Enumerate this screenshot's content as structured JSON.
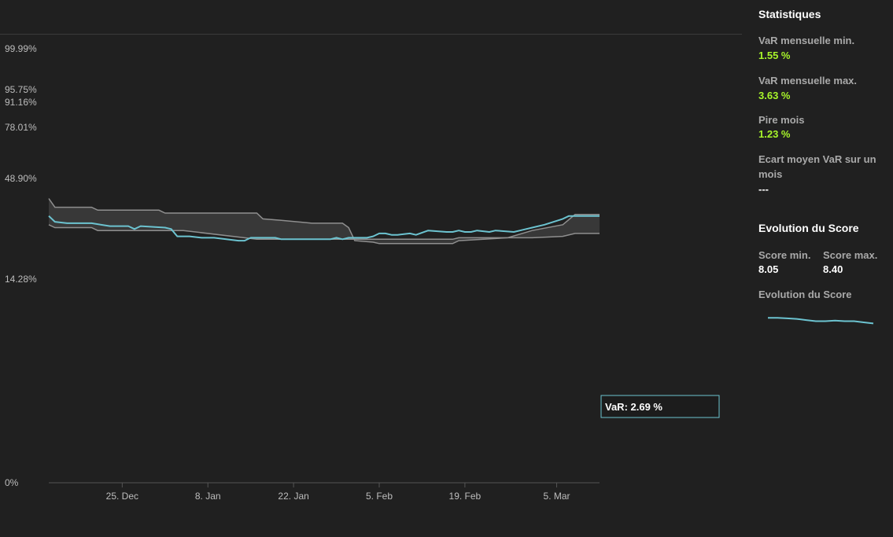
{
  "chart_data": {
    "type": "area",
    "ylabel": "",
    "xlabel": "",
    "y_tick_labels": [
      "99.99%",
      "95.75%",
      "91.16%",
      "78.01%",
      "48.90%",
      "14.28%",
      "0%"
    ],
    "y_tick_values": [
      1.0,
      0.9575,
      0.9116,
      0.7801,
      0.489,
      0.1428,
      0.0
    ],
    "y_scale": "nonlinear-probability",
    "x_tick_labels": [
      "25. Dec",
      "8. Jan",
      "22. Jan",
      "5. Feb",
      "19. Feb",
      "5. Mar"
    ],
    "x_tick_dates": [
      "2023-12-25",
      "2024-01-08",
      "2024-01-22",
      "2024-02-05",
      "2024-02-19",
      "2024-03-05"
    ],
    "x_range": [
      "2023-12-13",
      "2024-03-12"
    ],
    "band": {
      "x": [
        "2023-12-13",
        "2023-12-14",
        "2023-12-20",
        "2023-12-21",
        "2023-12-31",
        "2024-01-01",
        "2024-01-03",
        "2024-01-04",
        "2024-01-16",
        "2024-01-17",
        "2024-01-20",
        "2024-01-25",
        "2024-01-30",
        "2024-01-31",
        "2024-02-01",
        "2024-02-04",
        "2024-02-05",
        "2024-02-06",
        "2024-02-07",
        "2024-02-17",
        "2024-02-18",
        "2024-02-26",
        "2024-03-01",
        "2024-03-06",
        "2024-03-08",
        "2024-03-12"
      ],
      "upper": [
        0.42,
        0.39,
        0.39,
        0.38,
        0.38,
        0.37,
        0.37,
        0.37,
        0.37,
        0.35,
        0.345,
        0.335,
        0.335,
        0.32,
        0.275,
        0.27,
        0.265,
        0.265,
        0.265,
        0.265,
        0.275,
        0.285,
        0.31,
        0.33,
        0.365,
        0.365
      ],
      "lower": [
        0.33,
        0.32,
        0.32,
        0.31,
        0.31,
        0.31,
        0.31,
        0.31,
        0.28,
        0.28,
        0.28,
        0.28,
        0.28,
        0.28,
        0.28,
        0.28,
        0.28,
        0.28,
        0.28,
        0.28,
        0.285,
        0.285,
        0.285,
        0.29,
        0.3,
        0.3
      ]
    },
    "series": [
      {
        "x": [
          "2023-12-13",
          "2023-12-14",
          "2023-12-16",
          "2023-12-20",
          "2023-12-23",
          "2023-12-26",
          "2023-12-27",
          "2023-12-28",
          "2024-01-01",
          "2024-01-02",
          "2024-01-03",
          "2024-01-05",
          "2024-01-07",
          "2024-01-09",
          "2024-01-13",
          "2024-01-14",
          "2024-01-15",
          "2024-01-17",
          "2024-01-19",
          "2024-01-20",
          "2024-01-24",
          "2024-01-28",
          "2024-01-29",
          "2024-01-30",
          "2024-01-31",
          "2024-02-03",
          "2024-02-04",
          "2024-02-05",
          "2024-02-06",
          "2024-02-07",
          "2024-02-08",
          "2024-02-10",
          "2024-02-11",
          "2024-02-13",
          "2024-02-16",
          "2024-02-17",
          "2024-02-18",
          "2024-02-19",
          "2024-02-20",
          "2024-02-21",
          "2024-02-23",
          "2024-02-24",
          "2024-02-27",
          "2024-02-28",
          "2024-02-29",
          "2024-03-01",
          "2024-03-03",
          "2024-03-06",
          "2024-03-07",
          "2024-03-12"
        ],
        "values": [
          0.36,
          0.34,
          0.335,
          0.335,
          0.325,
          0.325,
          0.315,
          0.325,
          0.32,
          0.315,
          0.29,
          0.29,
          0.285,
          0.285,
          0.275,
          0.275,
          0.285,
          0.285,
          0.285,
          0.28,
          0.28,
          0.28,
          0.285,
          0.28,
          0.285,
          0.285,
          0.29,
          0.3,
          0.3,
          0.295,
          0.295,
          0.3,
          0.295,
          0.31,
          0.305,
          0.305,
          0.31,
          0.305,
          0.305,
          0.31,
          0.305,
          0.31,
          0.305,
          0.31,
          0.315,
          0.32,
          0.33,
          0.35,
          0.36,
          0.36
        ],
        "color": "#6cc3d0"
      }
    ],
    "band_fill": "#383838",
    "band_line_color": "#8f8f8f",
    "tooltip": "VaR: 2.69 %"
  },
  "stats": {
    "title": "Statistiques",
    "items": [
      {
        "label": "VaR mensuelle min.",
        "value": "1.55 %"
      },
      {
        "label": "VaR mensuelle max.",
        "value": "3.63 %"
      },
      {
        "label": "Pire mois",
        "value": "1.23 %"
      },
      {
        "label": "Ecart moyen VaR sur un mois",
        "value": "---"
      }
    ]
  },
  "score": {
    "title": "Evolution du Score",
    "min_label": "Score min.",
    "min_value": "8.05",
    "max_label": "Score max.",
    "max_value": "8.40",
    "spark_label": "Evolution du Score",
    "spark_values": [
      8.4,
      8.4,
      8.39,
      8.38,
      8.36,
      8.34,
      8.34,
      8.35,
      8.34,
      8.34,
      8.32,
      8.3
    ],
    "spark_color": "#6cc3d0"
  },
  "colors": {
    "background": "#202020",
    "accent_green": "#a8f52a",
    "line": "#6cc3d0"
  }
}
